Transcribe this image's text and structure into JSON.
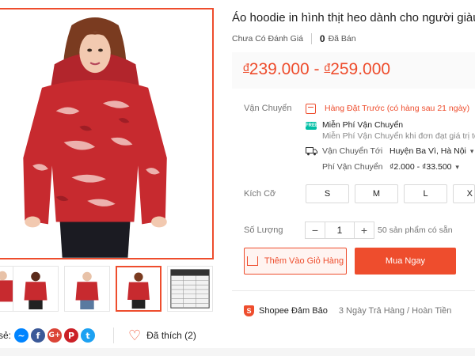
{
  "product": {
    "title": "Áo hoodie in hình thịt heo dành cho người giàu :)",
    "rating_status": "Chưa Có Đánh Giá",
    "sold_count": "0",
    "sold_label": "Đã Bán",
    "price_currency": "đ",
    "price_min": "239.000",
    "price_sep": " - ",
    "price_max": "259.000"
  },
  "shipping": {
    "label": "Vận Chuyển",
    "preorder": "Hàng Đặt Trước (có hàng sau 21 ngày)",
    "free_title": "Miễn Phí Vận Chuyển",
    "free_desc": "Miễn Phí Vận Chuyển khi đơn đạt giá trị tối t",
    "to_label": "Vận Chuyển Tới",
    "to_value": "Huyện Ba Vì, Hà Nội",
    "fee_label": "Phí Vận Chuyển",
    "fee_value": "₫2.000 - ₫33.500"
  },
  "size": {
    "label": "Kích Cỡ",
    "options": [
      "S",
      "M",
      "L",
      "X"
    ]
  },
  "quantity": {
    "label": "Số Lượng",
    "minus": "−",
    "value": "1",
    "plus": "+",
    "stock": "50 sản phẩm có sẵn"
  },
  "actions": {
    "add_to_cart": "Thêm Vào Giỏ Hàng",
    "buy_now": "Mua Ngay"
  },
  "guarantee": {
    "icon_letter": "S",
    "title": "Shopee Đảm Bảo",
    "desc": "3 Ngày Trả Hàng / Hoàn Tiền"
  },
  "share": {
    "label": "sẻ:",
    "icons": [
      "messenger-icon",
      "facebook-icon",
      "google-plus-icon",
      "pinterest-icon",
      "twitter-icon"
    ]
  },
  "like": {
    "label": "Đã thích (2)"
  },
  "colors": {
    "brand": "#ee4d2d",
    "free_ship": "#00bfa5"
  }
}
